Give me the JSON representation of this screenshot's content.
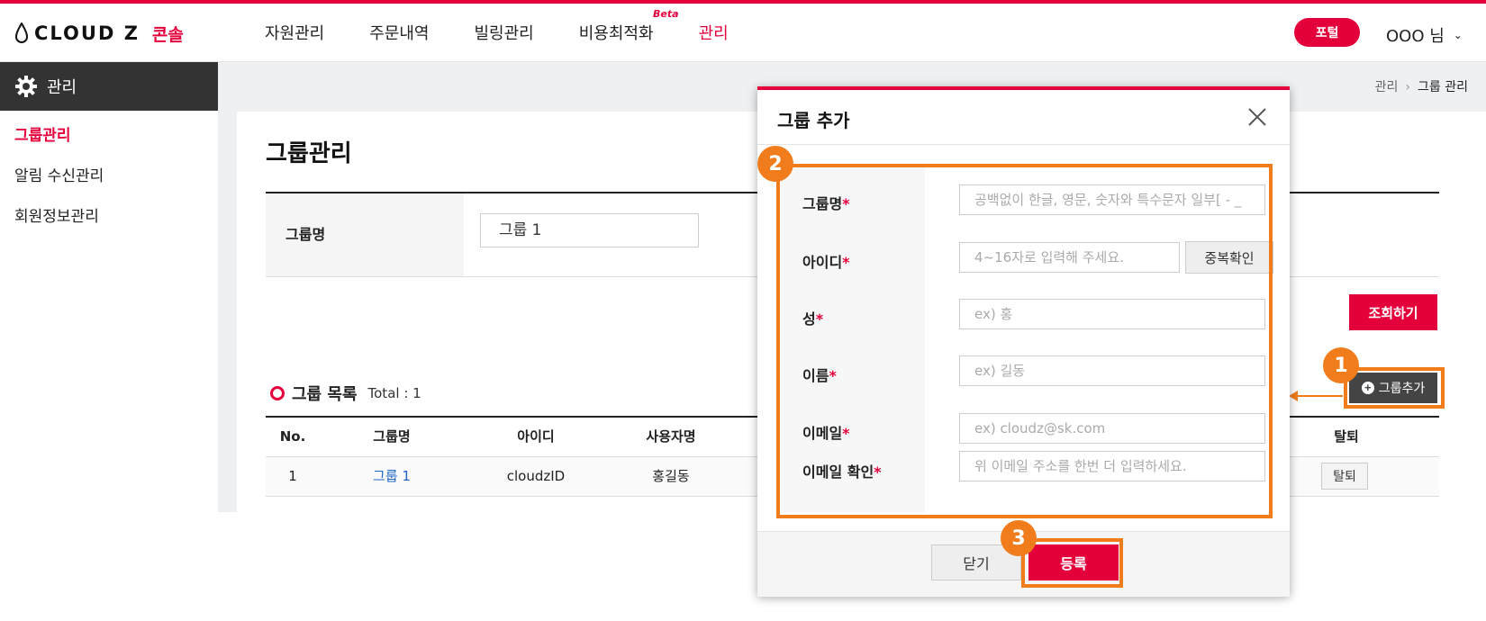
{
  "brand": {
    "name": "CLOUD Z",
    "sub": "콘솔"
  },
  "nav": {
    "items": [
      "자원관리",
      "주문내역",
      "빌링관리",
      "비용최적화",
      "관리"
    ],
    "beta_label": "Beta",
    "active": "관리"
  },
  "header": {
    "portal_label": "포털",
    "user_name": "OOO 님"
  },
  "sidebar": {
    "title": "관리",
    "items": [
      "그룹관리",
      "알림 수신관리",
      "회원정보관리"
    ]
  },
  "breadcrumb": {
    "root": "관리",
    "separator": "›",
    "current": "그룹 관리"
  },
  "page": {
    "title": "그룹관리",
    "search": {
      "label": "그룹명",
      "value": "그룹 1"
    },
    "search_button": "조회하기",
    "list_title": "그룹 목록",
    "total": "Total : 1",
    "add_button": "그룹추가"
  },
  "table": {
    "headers": [
      "No.",
      "그룹명",
      "아이디",
      "사용자명",
      "탈퇴"
    ],
    "rows": [
      {
        "no": "1",
        "group": "그룹 1",
        "id": "cloudzID",
        "user": "홍길동",
        "action": "탈퇴"
      }
    ]
  },
  "modal": {
    "title": "그룹 추가",
    "fields": [
      {
        "label": "그룹명",
        "placeholder": "공백없이 한글, 영문, 숫자와 특수문자 일부[ - _"
      },
      {
        "label": "아이디",
        "placeholder": "4~16자로 입력해 주세요."
      },
      {
        "label": "성",
        "placeholder": "ex) 홍"
      },
      {
        "label": "이름",
        "placeholder": "ex) 길동"
      },
      {
        "label": "이메일",
        "placeholder": "ex) cloudz@sk.com"
      },
      {
        "label": "이메일 확인",
        "placeholder": "위 이메일 주소를 한번 더 입력하세요."
      }
    ],
    "required_mark": "*",
    "dup_check": "중복확인",
    "close": "닫기",
    "register": "등록"
  },
  "annotations": {
    "step1": "1",
    "step2": "2",
    "step3": "3",
    "color": "#f07c1c"
  },
  "colors": {
    "accent": "#e4003b",
    "sidebar_head": "#333333",
    "background": "#eff0f2"
  }
}
